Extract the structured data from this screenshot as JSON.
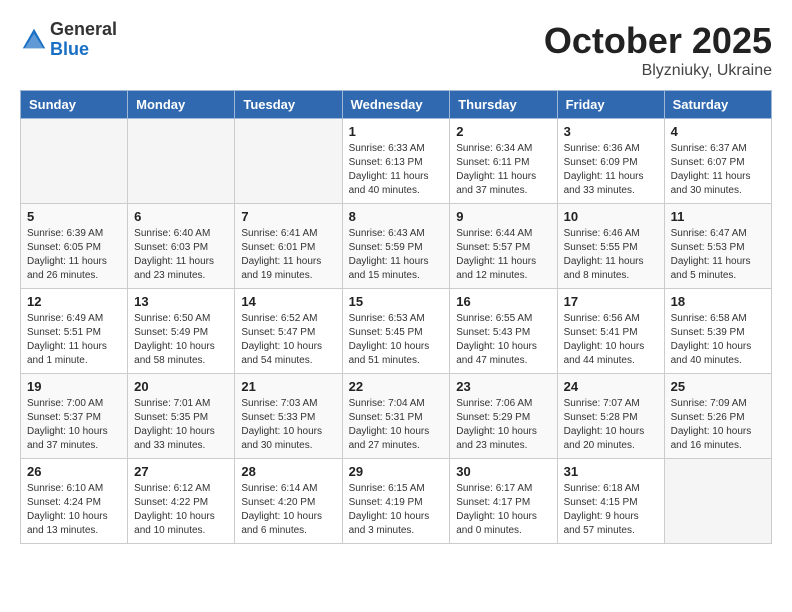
{
  "header": {
    "logo_general": "General",
    "logo_blue": "Blue",
    "title": "October 2025",
    "location": "Blyzniuky, Ukraine"
  },
  "calendar": {
    "headers": [
      "Sunday",
      "Monday",
      "Tuesday",
      "Wednesday",
      "Thursday",
      "Friday",
      "Saturday"
    ],
    "weeks": [
      {
        "days": [
          {
            "number": "",
            "info": "",
            "empty": true
          },
          {
            "number": "",
            "info": "",
            "empty": true
          },
          {
            "number": "",
            "info": "",
            "empty": true
          },
          {
            "number": "1",
            "info": "Sunrise: 6:33 AM\nSunset: 6:13 PM\nDaylight: 11 hours\nand 40 minutes.",
            "empty": false
          },
          {
            "number": "2",
            "info": "Sunrise: 6:34 AM\nSunset: 6:11 PM\nDaylight: 11 hours\nand 37 minutes.",
            "empty": false
          },
          {
            "number": "3",
            "info": "Sunrise: 6:36 AM\nSunset: 6:09 PM\nDaylight: 11 hours\nand 33 minutes.",
            "empty": false
          },
          {
            "number": "4",
            "info": "Sunrise: 6:37 AM\nSunset: 6:07 PM\nDaylight: 11 hours\nand 30 minutes.",
            "empty": false
          }
        ]
      },
      {
        "days": [
          {
            "number": "5",
            "info": "Sunrise: 6:39 AM\nSunset: 6:05 PM\nDaylight: 11 hours\nand 26 minutes.",
            "empty": false
          },
          {
            "number": "6",
            "info": "Sunrise: 6:40 AM\nSunset: 6:03 PM\nDaylight: 11 hours\nand 23 minutes.",
            "empty": false
          },
          {
            "number": "7",
            "info": "Sunrise: 6:41 AM\nSunset: 6:01 PM\nDaylight: 11 hours\nand 19 minutes.",
            "empty": false
          },
          {
            "number": "8",
            "info": "Sunrise: 6:43 AM\nSunset: 5:59 PM\nDaylight: 11 hours\nand 15 minutes.",
            "empty": false
          },
          {
            "number": "9",
            "info": "Sunrise: 6:44 AM\nSunset: 5:57 PM\nDaylight: 11 hours\nand 12 minutes.",
            "empty": false
          },
          {
            "number": "10",
            "info": "Sunrise: 6:46 AM\nSunset: 5:55 PM\nDaylight: 11 hours\nand 8 minutes.",
            "empty": false
          },
          {
            "number": "11",
            "info": "Sunrise: 6:47 AM\nSunset: 5:53 PM\nDaylight: 11 hours\nand 5 minutes.",
            "empty": false
          }
        ]
      },
      {
        "days": [
          {
            "number": "12",
            "info": "Sunrise: 6:49 AM\nSunset: 5:51 PM\nDaylight: 11 hours\nand 1 minute.",
            "empty": false
          },
          {
            "number": "13",
            "info": "Sunrise: 6:50 AM\nSunset: 5:49 PM\nDaylight: 10 hours\nand 58 minutes.",
            "empty": false
          },
          {
            "number": "14",
            "info": "Sunrise: 6:52 AM\nSunset: 5:47 PM\nDaylight: 10 hours\nand 54 minutes.",
            "empty": false
          },
          {
            "number": "15",
            "info": "Sunrise: 6:53 AM\nSunset: 5:45 PM\nDaylight: 10 hours\nand 51 minutes.",
            "empty": false
          },
          {
            "number": "16",
            "info": "Sunrise: 6:55 AM\nSunset: 5:43 PM\nDaylight: 10 hours\nand 47 minutes.",
            "empty": false
          },
          {
            "number": "17",
            "info": "Sunrise: 6:56 AM\nSunset: 5:41 PM\nDaylight: 10 hours\nand 44 minutes.",
            "empty": false
          },
          {
            "number": "18",
            "info": "Sunrise: 6:58 AM\nSunset: 5:39 PM\nDaylight: 10 hours\nand 40 minutes.",
            "empty": false
          }
        ]
      },
      {
        "days": [
          {
            "number": "19",
            "info": "Sunrise: 7:00 AM\nSunset: 5:37 PM\nDaylight: 10 hours\nand 37 minutes.",
            "empty": false
          },
          {
            "number": "20",
            "info": "Sunrise: 7:01 AM\nSunset: 5:35 PM\nDaylight: 10 hours\nand 33 minutes.",
            "empty": false
          },
          {
            "number": "21",
            "info": "Sunrise: 7:03 AM\nSunset: 5:33 PM\nDaylight: 10 hours\nand 30 minutes.",
            "empty": false
          },
          {
            "number": "22",
            "info": "Sunrise: 7:04 AM\nSunset: 5:31 PM\nDaylight: 10 hours\nand 27 minutes.",
            "empty": false
          },
          {
            "number": "23",
            "info": "Sunrise: 7:06 AM\nSunset: 5:29 PM\nDaylight: 10 hours\nand 23 minutes.",
            "empty": false
          },
          {
            "number": "24",
            "info": "Sunrise: 7:07 AM\nSunset: 5:28 PM\nDaylight: 10 hours\nand 20 minutes.",
            "empty": false
          },
          {
            "number": "25",
            "info": "Sunrise: 7:09 AM\nSunset: 5:26 PM\nDaylight: 10 hours\nand 16 minutes.",
            "empty": false
          }
        ]
      },
      {
        "days": [
          {
            "number": "26",
            "info": "Sunrise: 6:10 AM\nSunset: 4:24 PM\nDaylight: 10 hours\nand 13 minutes.",
            "empty": false
          },
          {
            "number": "27",
            "info": "Sunrise: 6:12 AM\nSunset: 4:22 PM\nDaylight: 10 hours\nand 10 minutes.",
            "empty": false
          },
          {
            "number": "28",
            "info": "Sunrise: 6:14 AM\nSunset: 4:20 PM\nDaylight: 10 hours\nand 6 minutes.",
            "empty": false
          },
          {
            "number": "29",
            "info": "Sunrise: 6:15 AM\nSunset: 4:19 PM\nDaylight: 10 hours\nand 3 minutes.",
            "empty": false
          },
          {
            "number": "30",
            "info": "Sunrise: 6:17 AM\nSunset: 4:17 PM\nDaylight: 10 hours\nand 0 minutes.",
            "empty": false
          },
          {
            "number": "31",
            "info": "Sunrise: 6:18 AM\nSunset: 4:15 PM\nDaylight: 9 hours\nand 57 minutes.",
            "empty": false
          },
          {
            "number": "",
            "info": "",
            "empty": true
          }
        ]
      }
    ]
  }
}
